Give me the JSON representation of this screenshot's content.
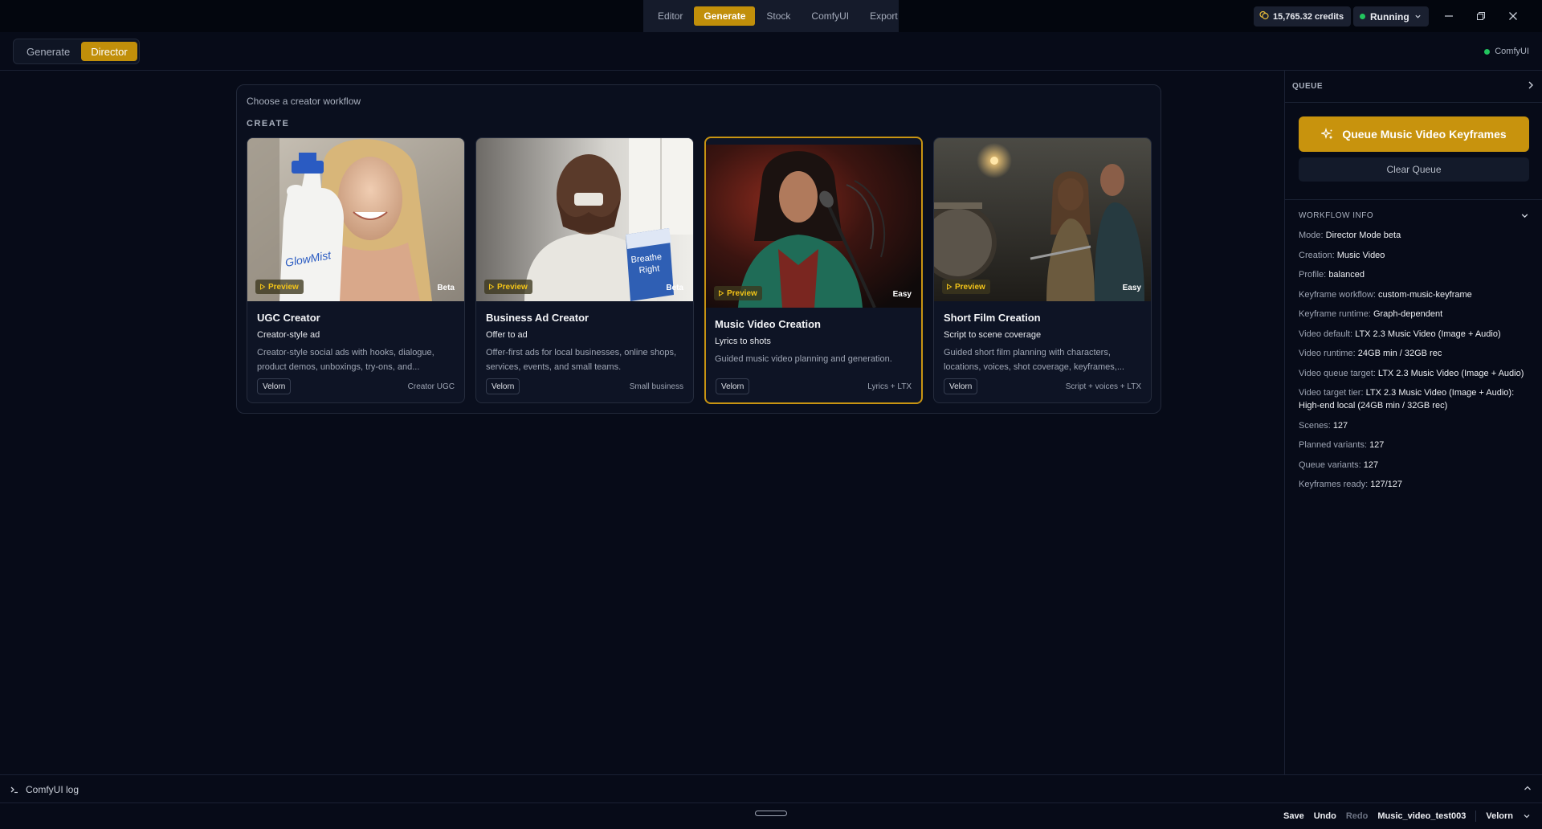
{
  "topnav": {
    "tabs": [
      "Editor",
      "Generate",
      "Stock",
      "ComfyUI",
      "Export"
    ],
    "active": "Generate"
  },
  "credits": "15,765.32 credits",
  "status": "Running",
  "mode_switch": {
    "generate": "Generate",
    "director": "Director"
  },
  "comfy_status": "ComfyUI",
  "main": {
    "title": "Choose a creator workflow",
    "section": "CREATE",
    "cards": [
      {
        "title": "UGC Creator",
        "subtitle": "Creator-style ad",
        "description": "Creator-style social ads with hooks, dialogue, product demos, unboxings, try-ons, and...",
        "preview": "Preview",
        "tier": "Beta",
        "provider": "Velorn",
        "tag": "Creator UGC",
        "product_text": "GlowMist"
      },
      {
        "title": "Business Ad Creator",
        "subtitle": "Offer to ad",
        "description": "Offer-first ads for local businesses, online shops, services, events, and small teams.",
        "preview": "Preview",
        "tier": "Beta",
        "provider": "Velorn",
        "tag": "Small business",
        "product_text_1": "Breathe",
        "product_text_2": "Right"
      },
      {
        "title": "Music Video Creation",
        "subtitle": "Lyrics to shots",
        "description": "Guided music video planning and generation.",
        "preview": "Preview",
        "tier": "Easy",
        "provider": "Velorn",
        "tag": "Lyrics + LTX",
        "selected": true
      },
      {
        "title": "Short Film Creation",
        "subtitle": "Script to scene coverage",
        "description": "Guided short film planning with characters, locations, voices, shot coverage, keyframes,...",
        "preview": "Preview",
        "tier": "Easy",
        "provider": "Velorn",
        "tag": "Script + voices + LTX"
      }
    ]
  },
  "sidebar": {
    "header": "QUEUE",
    "queue_button": "Queue Music Video Keyframes",
    "clear_button": "Clear Queue",
    "workflow_info_title": "WORKFLOW INFO",
    "workflow_info": [
      {
        "label": "Mode:",
        "value": "Director Mode beta"
      },
      {
        "label": "Creation:",
        "value": "Music Video"
      },
      {
        "label": "Profile:",
        "value": "balanced"
      },
      {
        "label": "Keyframe workflow:",
        "value": "custom-music-keyframe"
      },
      {
        "label": "Keyframe runtime:",
        "value": "Graph-dependent"
      },
      {
        "label": "Video default:",
        "value": "LTX 2.3 Music Video (Image + Audio)"
      },
      {
        "label": "Video runtime:",
        "value": "24GB min / 32GB rec"
      },
      {
        "label": "Video queue target:",
        "value": "LTX 2.3 Music Video (Image + Audio)"
      },
      {
        "label": "Video target tier:",
        "value": "LTX 2.3 Music Video (Image + Audio): High-end local (24GB min / 32GB rec)"
      },
      {
        "label": "Scenes:",
        "value": "127"
      },
      {
        "label": "Planned variants:",
        "value": "127"
      },
      {
        "label": "Queue variants:",
        "value": "127"
      },
      {
        "label": "Keyframes ready:",
        "value": "127/127"
      }
    ]
  },
  "log": {
    "label": "ComfyUI log"
  },
  "statusbar": {
    "save": "Save",
    "undo": "Undo",
    "redo": "Redo",
    "project": "Music_video_test003",
    "brand": "Velorn"
  },
  "colors": {
    "accent": "#c8930d",
    "background": "#070b18",
    "running": "#22c55e"
  }
}
